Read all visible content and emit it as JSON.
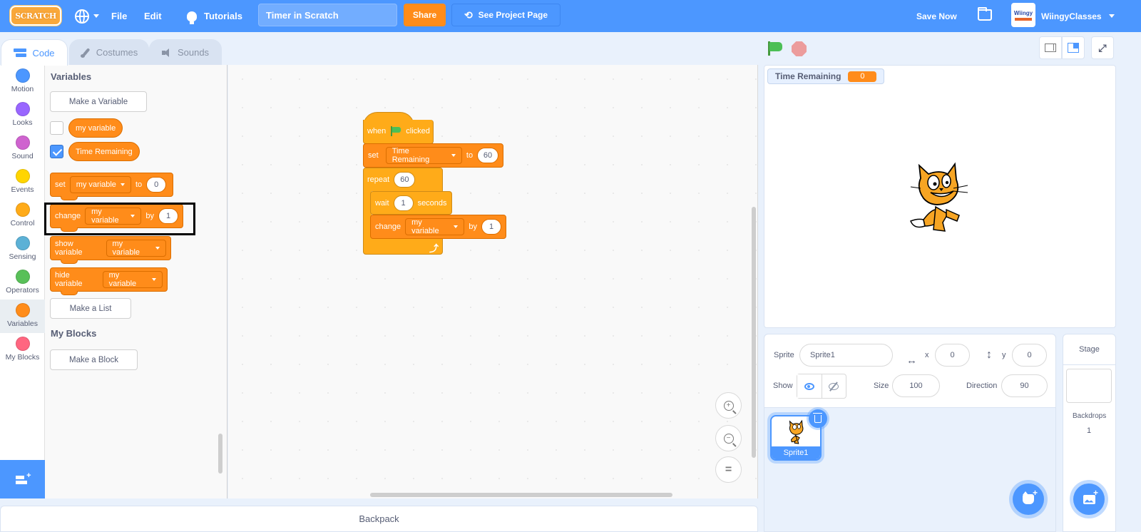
{
  "menubar": {
    "logo": "SCRATCH",
    "language_icon": "globe-icon",
    "file": "File",
    "edit": "Edit",
    "tutorials": "Tutorials",
    "project_title": "Timer in Scratch",
    "share": "Share",
    "see_project_page": "See Project Page",
    "save_now": "Save Now",
    "account_avatar_text": "Wiingy",
    "username": "WiingyClasses"
  },
  "tabs": [
    {
      "label": "Code",
      "active": true
    },
    {
      "label": "Costumes",
      "active": false
    },
    {
      "label": "Sounds",
      "active": false
    }
  ],
  "categories": [
    {
      "label": "Motion",
      "color": "#4c97ff"
    },
    {
      "label": "Looks",
      "color": "#9966ff"
    },
    {
      "label": "Sound",
      "color": "#cf63cf"
    },
    {
      "label": "Events",
      "color": "#ffd500"
    },
    {
      "label": "Control",
      "color": "#ffab19"
    },
    {
      "label": "Sensing",
      "color": "#5cb1d6"
    },
    {
      "label": "Operators",
      "color": "#59c059"
    },
    {
      "label": "Variables",
      "color": "#ff8c1a",
      "selected": true
    },
    {
      "label": "My Blocks",
      "color": "#ff6680"
    }
  ],
  "palette": {
    "variables_heading": "Variables",
    "make_variable": "Make a Variable",
    "variables": [
      {
        "name": "my variable",
        "checked": false
      },
      {
        "name": "Time Remaining",
        "checked": true
      }
    ],
    "blocks": {
      "set": {
        "label": "set",
        "var": "my variable",
        "to": "to",
        "value": "0"
      },
      "change": {
        "label": "change",
        "var": "my variable",
        "by": "by",
        "value": "1"
      },
      "show": {
        "label": "show variable",
        "var": "my variable"
      },
      "hide": {
        "label": "hide variable",
        "var": "my variable"
      }
    },
    "make_list": "Make a List",
    "myblocks_heading": "My Blocks",
    "make_block": "Make a Block"
  },
  "script": {
    "hat": {
      "when": "when",
      "clicked": "clicked"
    },
    "set": {
      "label": "set",
      "var": "Time Remaining",
      "to": "to",
      "value": "60"
    },
    "repeat": {
      "label": "repeat",
      "value": "60"
    },
    "wait": {
      "label": "wait",
      "value": "1",
      "unit": "seconds"
    },
    "change": {
      "label": "change",
      "var": "my variable",
      "by": "by",
      "value": "1"
    }
  },
  "backpack": "Backpack",
  "stage": {
    "monitor_label": "Time Remaining",
    "monitor_value": "0"
  },
  "sprite_info": {
    "sprite_label": "Sprite",
    "sprite_name": "Sprite1",
    "x_label": "x",
    "x": "0",
    "y_label": "y",
    "y": "0",
    "show_label": "Show",
    "size_label": "Size",
    "size": "100",
    "direction_label": "Direction",
    "direction": "90"
  },
  "sprites": [
    {
      "name": "Sprite1",
      "selected": true
    }
  ],
  "stage_pane": {
    "title": "Stage",
    "backdrops_label": "Backdrops",
    "backdrops_count": "1"
  }
}
